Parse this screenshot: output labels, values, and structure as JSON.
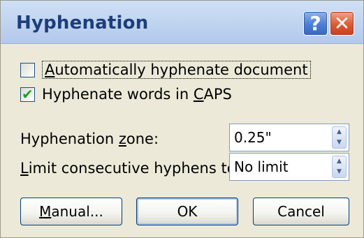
{
  "dialog": {
    "title": "Hyphenation",
    "help_glyph": "?",
    "close_glyph": "✕"
  },
  "options": {
    "auto_hyphenate": {
      "label_underlined": "A",
      "label_rest": "utomatically hyphenate document",
      "checked": false
    },
    "hyphenate_caps": {
      "label_pre": "Hyphenate words in ",
      "label_underlined": "C",
      "label_post": "APS",
      "checked": true,
      "check_glyph": "✔"
    }
  },
  "fields": {
    "zone": {
      "label_pre": "Hyphenation ",
      "label_underlined": "z",
      "label_post": "one:",
      "value": "0.25\""
    },
    "limit": {
      "label_underlined": "L",
      "label_rest": "imit consecutive hyphens to:",
      "value": "No limit"
    }
  },
  "spin_glyphs": {
    "up": "▲",
    "down": "▼"
  },
  "buttons": {
    "manual": {
      "label_underlined": "M",
      "label_rest": "anual..."
    },
    "ok": "OK",
    "cancel": "Cancel"
  },
  "colors": {
    "title_text": "#1d3e7c",
    "dialog_bg": "#ece9d8",
    "check_green": "#21a121"
  }
}
